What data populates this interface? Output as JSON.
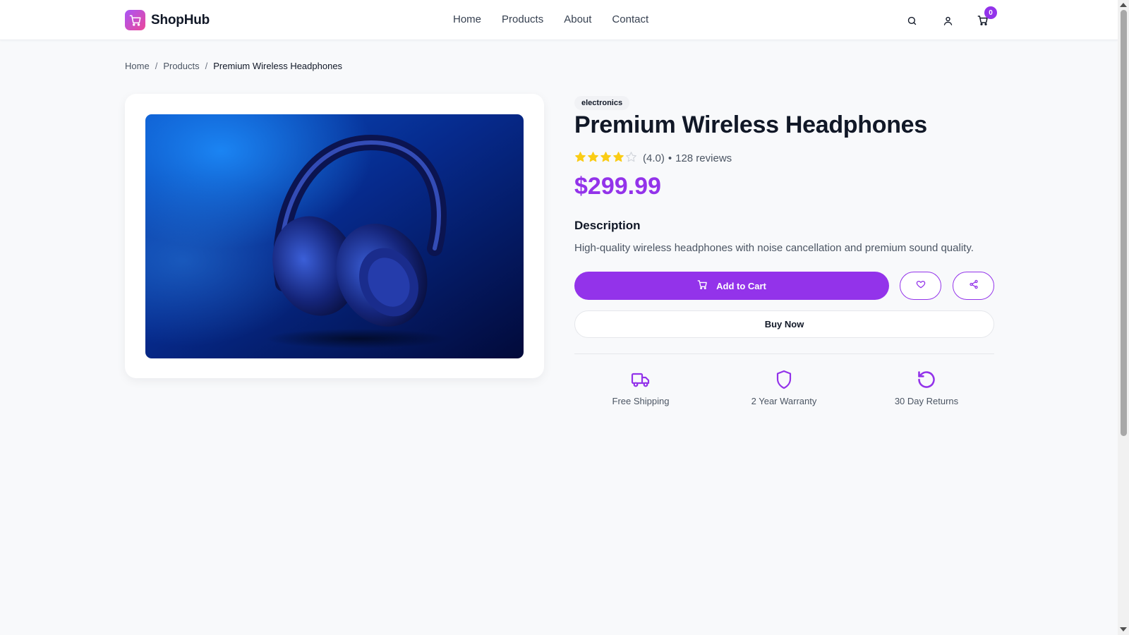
{
  "header": {
    "brand": "ShopHub",
    "nav": [
      "Home",
      "Products",
      "About",
      "Contact"
    ],
    "cart_count": "0"
  },
  "breadcrumb": {
    "home": "Home",
    "products": "Products",
    "current": "Premium Wireless Headphones",
    "separator": "/"
  },
  "product": {
    "category": "electronics",
    "title": "Premium Wireless Headphones",
    "rating": 4.0,
    "rating_text": "(4.0)",
    "bullet": "•",
    "reviews_text": "128 reviews",
    "price": "$299.99",
    "description_heading": "Description",
    "description": "High-quality wireless headphones with noise cancellation and premium sound quality.",
    "image_icon": "headphones-photo"
  },
  "actions": {
    "add_to_cart": "Add to Cart",
    "buy_now": "Buy Now",
    "wishlist_icon": "heart-icon",
    "share_icon": "share-icon"
  },
  "features": [
    {
      "icon": "truck-icon",
      "label": "Free Shipping"
    },
    {
      "icon": "shield-icon",
      "label": "2 Year Warranty"
    },
    {
      "icon": "rotate-ccw-icon",
      "label": "30 Day Returns"
    }
  ],
  "colors": {
    "accent": "#9333ea",
    "star": "#facc15",
    "background": "#f8f9fb"
  }
}
